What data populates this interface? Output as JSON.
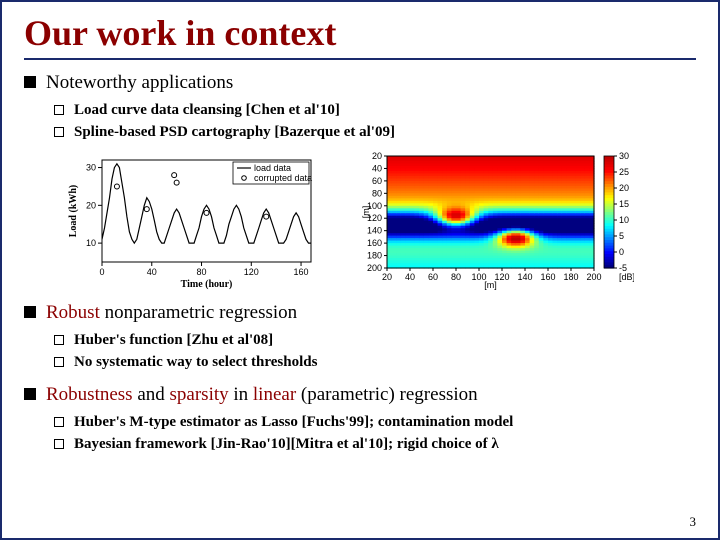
{
  "title": "Our work in context",
  "section1": {
    "heading": "Noteworthy applications",
    "items": [
      "Load curve data cleansing [Chen et al'10]",
      "Spline-based PSD cartography [Bazerque et al'09]"
    ]
  },
  "section2": {
    "heading_red": "Robust",
    "heading_rest": " nonparametric regression",
    "items": [
      "Huber's function [Zhu et al'08]",
      "No systematic way to select thresholds"
    ]
  },
  "section3": {
    "heading_parts": {
      "a": "Robustness",
      "b": " and ",
      "c": "sparsity",
      "d": " in ",
      "e": "linear",
      "f": " (parametric) regression"
    },
    "items": [
      "Huber's M-type estimator as Lasso [Fuchs'99]; contamination model",
      "Bayesian framework [Jin-Rao'10][Mitra et al'10]; rigid choice of "
    ],
    "lambda": "λ"
  },
  "page_number": "3",
  "chart_data": [
    {
      "type": "line",
      "title": "",
      "legend": [
        "load data",
        "corrupted data"
      ],
      "xlabel": "Time (hour)",
      "ylabel": "Load (kWh)",
      "xlim": [
        0,
        168
      ],
      "ylim": [
        5,
        32
      ],
      "xticks": [
        0,
        40,
        80,
        120,
        160
      ],
      "yticks": [
        10,
        20,
        30
      ],
      "x": [
        0,
        2,
        4,
        6,
        8,
        10,
        12,
        14,
        16,
        18,
        20,
        22,
        24,
        26,
        28,
        30,
        32,
        34,
        36,
        38,
        40,
        42,
        44,
        46,
        48,
        50,
        52,
        54,
        56,
        58,
        60,
        62,
        64,
        66,
        68,
        70,
        72,
        74,
        76,
        78,
        80,
        82,
        84,
        86,
        88,
        90,
        92,
        94,
        96,
        98,
        100,
        102,
        104,
        106,
        108,
        110,
        112,
        114,
        116,
        118,
        120,
        122,
        124,
        126,
        128,
        130,
        132,
        134,
        136,
        138,
        140,
        142,
        144,
        146,
        148,
        150,
        152,
        154,
        156,
        158,
        160,
        162,
        164,
        166,
        168
      ],
      "series": [
        {
          "name": "load data",
          "values": [
            11,
            14,
            18,
            22,
            27,
            30,
            31,
            30,
            26,
            22,
            17,
            13,
            11,
            10,
            11,
            14,
            17,
            20,
            22,
            21,
            19,
            16,
            13,
            11,
            10,
            10,
            12,
            14,
            16,
            18,
            19,
            18,
            16,
            14,
            12,
            10,
            10,
            10,
            12,
            14,
            17,
            19,
            20,
            19,
            17,
            14,
            12,
            10,
            10,
            10,
            12,
            15,
            17,
            19,
            20,
            19,
            17,
            14,
            12,
            10,
            10,
            10,
            12,
            14,
            16,
            18,
            19,
            18,
            16,
            14,
            12,
            10,
            10,
            10,
            11,
            13,
            15,
            17,
            18,
            17,
            15,
            13,
            11,
            10,
            10
          ]
        }
      ],
      "corrupted_points": {
        "x": [
          12,
          36,
          58,
          60,
          84,
          132
        ],
        "y": [
          25,
          19,
          28,
          26,
          18,
          17
        ]
      }
    },
    {
      "type": "heatmap",
      "title": "",
      "xlabel": "[m]",
      "ylabel": "[m]",
      "colorbar_label": "[dB]",
      "xlim": [
        20,
        200
      ],
      "ylim": [
        20,
        200
      ],
      "clim": [
        -5,
        30
      ],
      "xticks": [
        20,
        40,
        60,
        80,
        100,
        120,
        140,
        160,
        180,
        200
      ],
      "yticks": [
        20,
        40,
        60,
        80,
        100,
        120,
        140,
        160,
        180,
        200
      ],
      "cticks": [
        -5,
        0,
        5,
        10,
        15,
        20,
        25,
        30
      ],
      "note": "2D spatial heatmap with peak intensity (~30 dB) in top region, dropping to ~-5 dB in a band around y≈120–140, and two localized high spots near (80,120) and (130,150)."
    }
  ]
}
